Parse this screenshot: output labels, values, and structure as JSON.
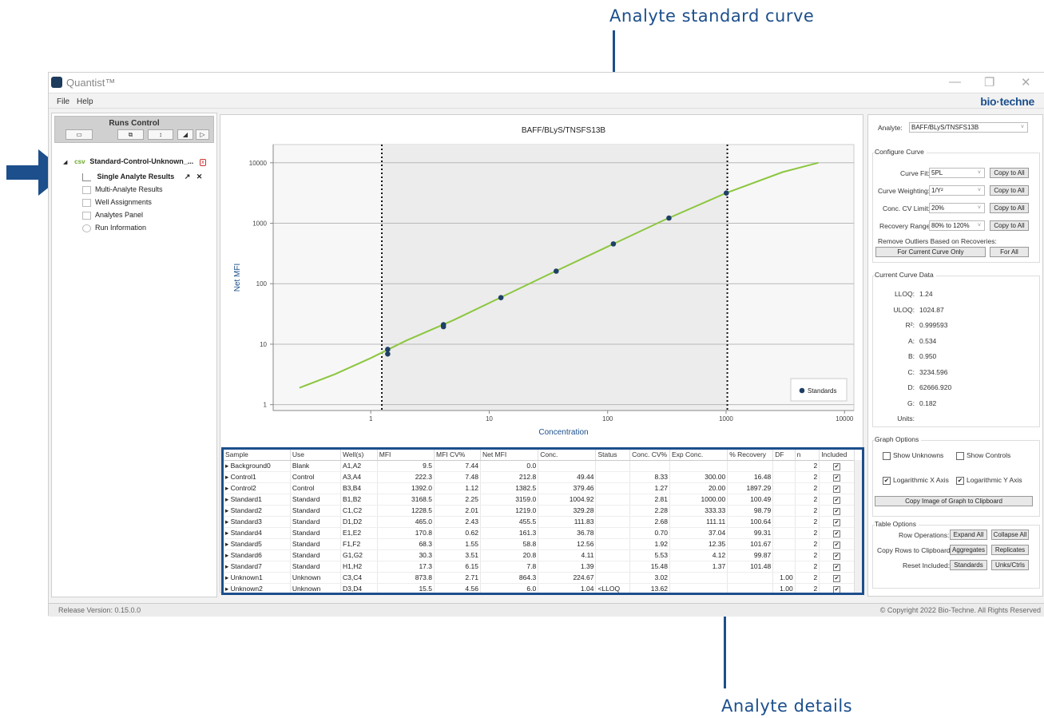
{
  "callouts": {
    "top": "Analyte standard curve",
    "bottom": "Analyte details"
  },
  "app": {
    "title": "Quantist™",
    "menu": [
      "File",
      "Help"
    ],
    "brand": "bio·techne",
    "release": "Release Version: 0.15.0.0",
    "copyright": "© Copyright 2022 Bio-Techne. All Rights Reserved"
  },
  "runs": {
    "title": "Runs Control",
    "root": "Standard-Control-Unknown_...",
    "root_icon": "csv-file-icon",
    "items": [
      "Single Analyte Results",
      "Multi-Analyte Results",
      "Well Assignments",
      "Analytes Panel",
      "Run Information"
    ]
  },
  "chart_data": {
    "type": "scatter",
    "title": "BAFF/BLyS/TNSFS13B",
    "xlabel": "Concentration",
    "ylabel": "Net MFI",
    "xscale": "log",
    "yscale": "log",
    "xlim": [
      0.15,
      12000
    ],
    "ylim": [
      0.8,
      20000
    ],
    "xticks": [
      "1",
      "10",
      "100",
      "1000",
      "10000"
    ],
    "yticks": [
      "1",
      "10",
      "100",
      "1000",
      "10000"
    ],
    "legend": "Standards",
    "legend_position": "bottom-right",
    "vlines": [
      1.24,
      1024.87
    ],
    "standards": [
      {
        "x": 1.39,
        "y": 6.9
      },
      {
        "x": 1.39,
        "y": 8.2
      },
      {
        "x": 4.11,
        "y": 19.5
      },
      {
        "x": 4.11,
        "y": 21.0
      },
      {
        "x": 12.56,
        "y": 58.8
      },
      {
        "x": 36.78,
        "y": 161.3
      },
      {
        "x": 111.83,
        "y": 455.5
      },
      {
        "x": 329.28,
        "y": 1219.0
      },
      {
        "x": 1004.92,
        "y": 3159.0
      }
    ],
    "curve": [
      {
        "x": 0.25,
        "y": 1.9
      },
      {
        "x": 0.5,
        "y": 3.2
      },
      {
        "x": 1,
        "y": 5.9
      },
      {
        "x": 2,
        "y": 11.5
      },
      {
        "x": 5,
        "y": 25
      },
      {
        "x": 10,
        "y": 48
      },
      {
        "x": 30,
        "y": 135
      },
      {
        "x": 100,
        "y": 410
      },
      {
        "x": 300,
        "y": 1130
      },
      {
        "x": 1000,
        "y": 3160
      },
      {
        "x": 3000,
        "y": 7000
      },
      {
        "x": 6000,
        "y": 10000
      }
    ]
  },
  "table": {
    "columns": [
      "Sample",
      "Use",
      "Well(s)",
      "MFI",
      "MFI CV%",
      "Net MFI",
      "Conc.",
      "Status",
      "Conc. CV%",
      "Exp Conc.",
      "% Recovery",
      "DF",
      "n",
      "Included"
    ],
    "rows": [
      [
        "Background0",
        "Blank",
        "A1,A2",
        "9.5",
        "7.44",
        "0.0",
        "",
        "",
        "",
        "",
        "",
        "",
        "2",
        "✔"
      ],
      [
        "Control1",
        "Control",
        "A3,A4",
        "222.3",
        "7.48",
        "212.8",
        "49.44",
        "",
        "8.33",
        "300.00",
        "16.48",
        "",
        "2",
        "✔"
      ],
      [
        "Control2",
        "Control",
        "B3,B4",
        "1392.0",
        "1.12",
        "1382.5",
        "379.46",
        "",
        "1.27",
        "20.00",
        "1897.29",
        "",
        "2",
        "✔"
      ],
      [
        "Standard1",
        "Standard",
        "B1,B2",
        "3168.5",
        "2.25",
        "3159.0",
        "1004.92",
        "",
        "2.81",
        "1000.00",
        "100.49",
        "",
        "2",
        "✔"
      ],
      [
        "Standard2",
        "Standard",
        "C1,C2",
        "1228.5",
        "2.01",
        "1219.0",
        "329.28",
        "",
        "2.28",
        "333.33",
        "98.79",
        "",
        "2",
        "✔"
      ],
      [
        "Standard3",
        "Standard",
        "D1,D2",
        "465.0",
        "2.43",
        "455.5",
        "111.83",
        "",
        "2.68",
        "111.11",
        "100.64",
        "",
        "2",
        "✔"
      ],
      [
        "Standard4",
        "Standard",
        "E1,E2",
        "170.8",
        "0.62",
        "161.3",
        "36.78",
        "",
        "0.70",
        "37.04",
        "99.31",
        "",
        "2",
        "✔"
      ],
      [
        "Standard5",
        "Standard",
        "F1,F2",
        "68.3",
        "1.55",
        "58.8",
        "12.56",
        "",
        "1.92",
        "12.35",
        "101.67",
        "",
        "2",
        "✔"
      ],
      [
        "Standard6",
        "Standard",
        "G1,G2",
        "30.3",
        "3.51",
        "20.8",
        "4.11",
        "",
        "5.53",
        "4.12",
        "99.87",
        "",
        "2",
        "✔"
      ],
      [
        "Standard7",
        "Standard",
        "H1,H2",
        "17.3",
        "6.15",
        "7.8",
        "1.39",
        "",
        "15.48",
        "1.37",
        "101.48",
        "",
        "2",
        "✔"
      ],
      [
        "Unknown1",
        "Unknown",
        "C3,C4",
        "873.8",
        "2.71",
        "864.3",
        "224.67",
        "",
        "3.02",
        "",
        "",
        "1.00",
        "2",
        "✔"
      ],
      [
        "Unknown2",
        "Unknown",
        "D3,D4",
        "15.5",
        "4.56",
        "6.0",
        "1.04",
        "<LLOQ",
        "13.62",
        "",
        "",
        "1.00",
        "2",
        "✔"
      ]
    ]
  },
  "right": {
    "analyte_label": "Analyte:",
    "analyte_value": "BAFF/BLyS/TNSFS13B",
    "configure_title": "Configure Curve",
    "curve_fit_label": "Curve Fit:",
    "curve_fit_value": "5PL",
    "weighting_label": "Curve Weighting:",
    "weighting_value": "1/Y²",
    "cv_label": "Conc. CV Limit:",
    "cv_value": "20%",
    "recovery_label": "Recovery Range:",
    "recovery_value": "80% to 120%",
    "copy_all": "Copy to All",
    "outliers_label": "Remove Outliers Based on Recoveries:",
    "outliers_current": "For Current Curve Only",
    "outliers_all": "For All",
    "current_title": "Current Curve Data",
    "curve_data": [
      {
        "k": "LLOQ:",
        "v": "1.24"
      },
      {
        "k": "ULOQ:",
        "v": "1024.87"
      },
      {
        "k": "R²:",
        "v": "0.999593"
      },
      {
        "k": "A:",
        "v": "0.534"
      },
      {
        "k": "B:",
        "v": "0.950"
      },
      {
        "k": "C:",
        "v": "3234.596"
      },
      {
        "k": "D:",
        "v": "62666.920"
      },
      {
        "k": "G:",
        "v": "0.182"
      },
      {
        "k": "Units:",
        "v": ""
      }
    ],
    "graph_title": "Graph Options",
    "show_unknowns": "Show Unknowns",
    "show_controls": "Show Controls",
    "log_x": "Logarithmic X Axis",
    "log_y": "Logarithmic Y Axis",
    "copy_graph": "Copy Image of Graph to Clipboard",
    "table_title": "Table Options",
    "row_ops": "Row Operations:",
    "expand": "Expand All",
    "collapse": "Collapse All",
    "copy_rows": "Copy Rows to Clipboard:",
    "aggregates": "Aggregates",
    "replicates": "Replicates",
    "reset": "Reset Included:",
    "standards": "Standards",
    "unks": "Unks/Ctrls"
  }
}
